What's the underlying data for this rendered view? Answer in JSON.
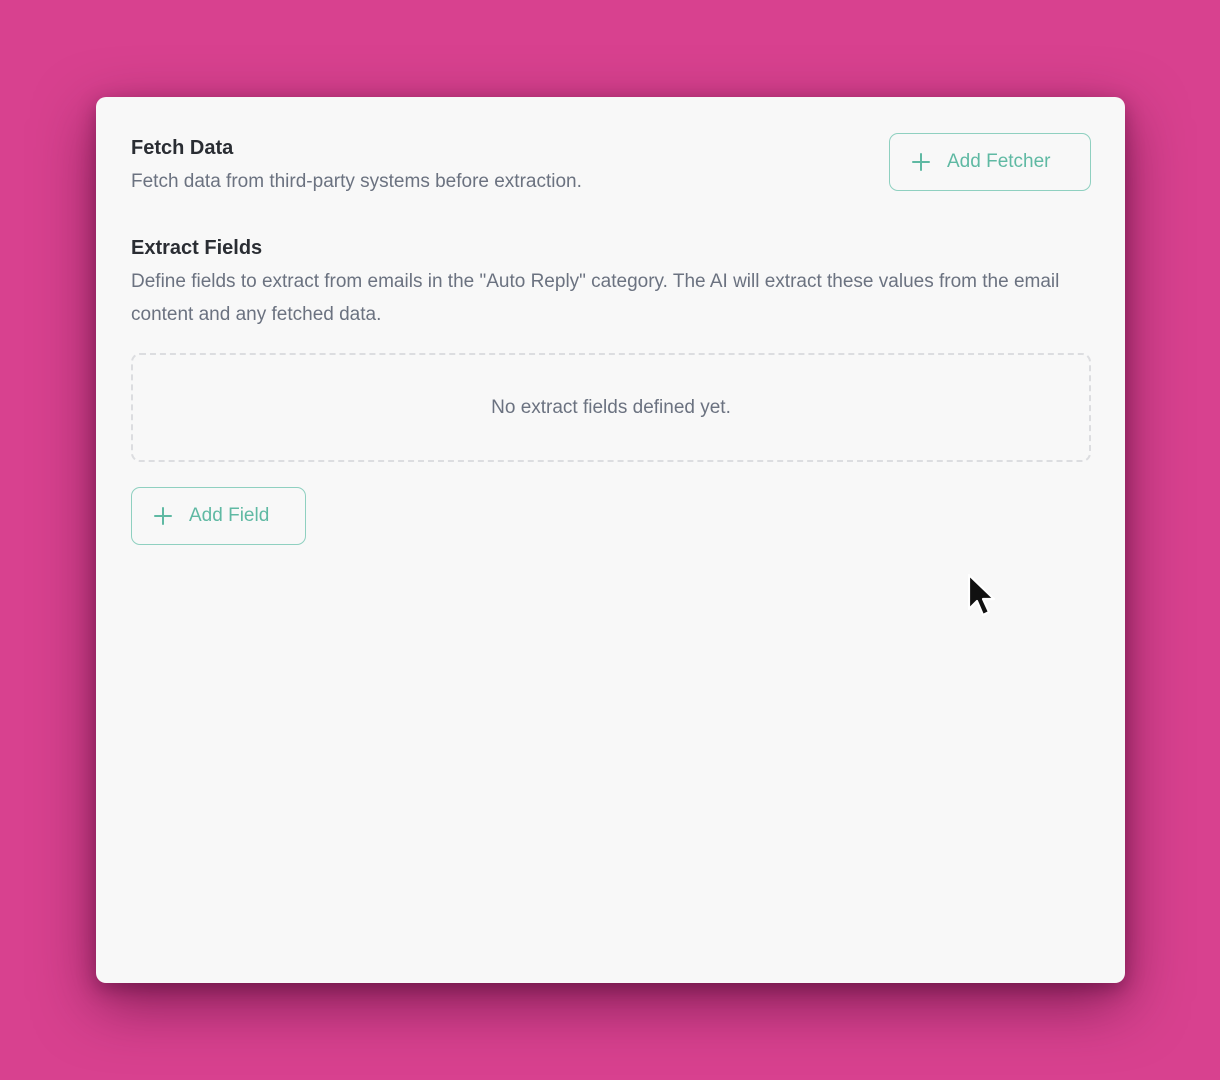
{
  "fetch_section": {
    "title": "Fetch Data",
    "description": "Fetch data from third-party systems before extraction.",
    "add_button_label": "Add Fetcher"
  },
  "extract_section": {
    "title": "Extract Fields",
    "description": "Define fields to extract from emails in the \"Auto Reply\" category. The AI will extract these values from the email content and any fetched data.",
    "empty_state": "No extract fields defined yet.",
    "add_button_label": "Add Field"
  },
  "icons": {
    "add": "plus-icon",
    "cursor": "mouse-pointer-icon"
  },
  "colors": {
    "background": "#d8418f",
    "panel": "#f8f8f8",
    "accent": "#5fb9a3",
    "accent_border": "#8fd0c0",
    "title_text": "#2a2d33",
    "muted_text": "#6b7280"
  }
}
